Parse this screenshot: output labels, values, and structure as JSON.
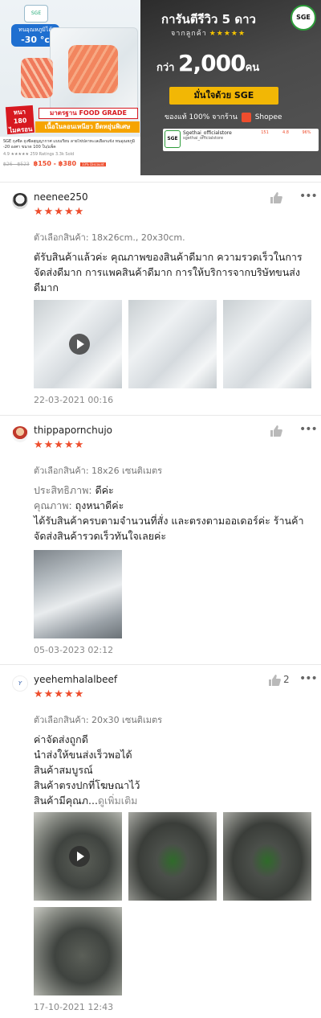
{
  "banner": {
    "left": {
      "cold_tag": "ทนอุณหภูมิได้",
      "cold_value": "-30 °c",
      "thick_tag": "หนา 180 ไมครอน",
      "food_grade": "มาตรฐาน FOOD GRADE",
      "sub_tag": "เนื้อในลอนเหนียว ยืดหยุ่นพิเศษ",
      "product_title": "SGE ถุงซีล ถุงซีลสุญญากาศ แบบเรียบ ลายไข่ปลาทะเลเยือกแข็ง ทนอุณหภูมิ -20 องศา ขนาด 100 ใบ/แพ็ค",
      "rating_text": "4.9 ★★★★★  259 Ratings  3.3k Sold",
      "old_price": "฿26 - ฿523",
      "new_price": "฿150 - ฿380",
      "discount": "33% Discount"
    },
    "right": {
      "headline": "การันตีรีวิว 5 ดาว",
      "from_customers": "จากลูกค้า",
      "from_stars": "★★★★★",
      "badge": "SGE",
      "count_prefix": "กว่า",
      "count_value": "2,000",
      "count_suffix": "คน",
      "trust": "มั่นใจด้วย SGE",
      "genuine_prefix": "ของแท้ 100% จากร้าน",
      "genuine_shop": "Shopee",
      "store_name": "Sgethai_officialstore",
      "store_sub": "sgethai_officialstore",
      "store_stat1": "151",
      "store_stat2": "4.8",
      "store_stat3": "96%"
    }
  },
  "reviews": [
    {
      "username": "neenee250",
      "stars": "★★★★★",
      "likes": "",
      "variant": "ตัวเลือกสินค้า: 18x26cm., 20x30cm.",
      "lines": [
        "ตัรับสินค้าแล้วค่ะ คุณภาพของสินค้าดีมาก ความรวดเร็วในการ",
        "จัดส่งดีมาก การแพคสินค้าดีมาก การให้บริการจากบริษัทขนส่ง",
        "ดีมาก"
      ],
      "date": "22-03-2021 00:16"
    },
    {
      "username": "thippapornchujo",
      "stars": "★★★★★",
      "likes": "",
      "variant": "ตัวเลือกสินค้า: 18x26 เซนติเมตร",
      "perf_label": "ประสิทธิภาพ:",
      "perf_value": "ดีค่ะ",
      "quality_label": "คุณภาพ:",
      "quality_value": "ถุงหนาดีค่ะ",
      "lines": [
        "ได้รับสินค้าครบตามจำนวนที่สั่ง และตรงตามออเดอร์ค่ะ ร้านค้า",
        "จัดส่งสินค้ารวดเร็วทันใจเลยค่ะ"
      ],
      "date": "05-03-2023 02:12"
    },
    {
      "username": "yeehemhalalbeef",
      "stars": "★★★★★",
      "likes": "2",
      "variant": "ตัวเลือกสินค้า: 20x30 เซนติเมตร",
      "lines": [
        "ค่าจัดส่งถูกดี",
        "นำส่งให้ขนส่งเร็วพอได้",
        "สินค้าสมบูรณ์",
        "สินค้าตรงปกที่โฆษณาไว้",
        "สินค้ามีคุณภ..."
      ],
      "see_more": "ดูเพิ่มเติม",
      "date": "17-10-2021 12:43"
    }
  ],
  "more_glyph": "•••"
}
